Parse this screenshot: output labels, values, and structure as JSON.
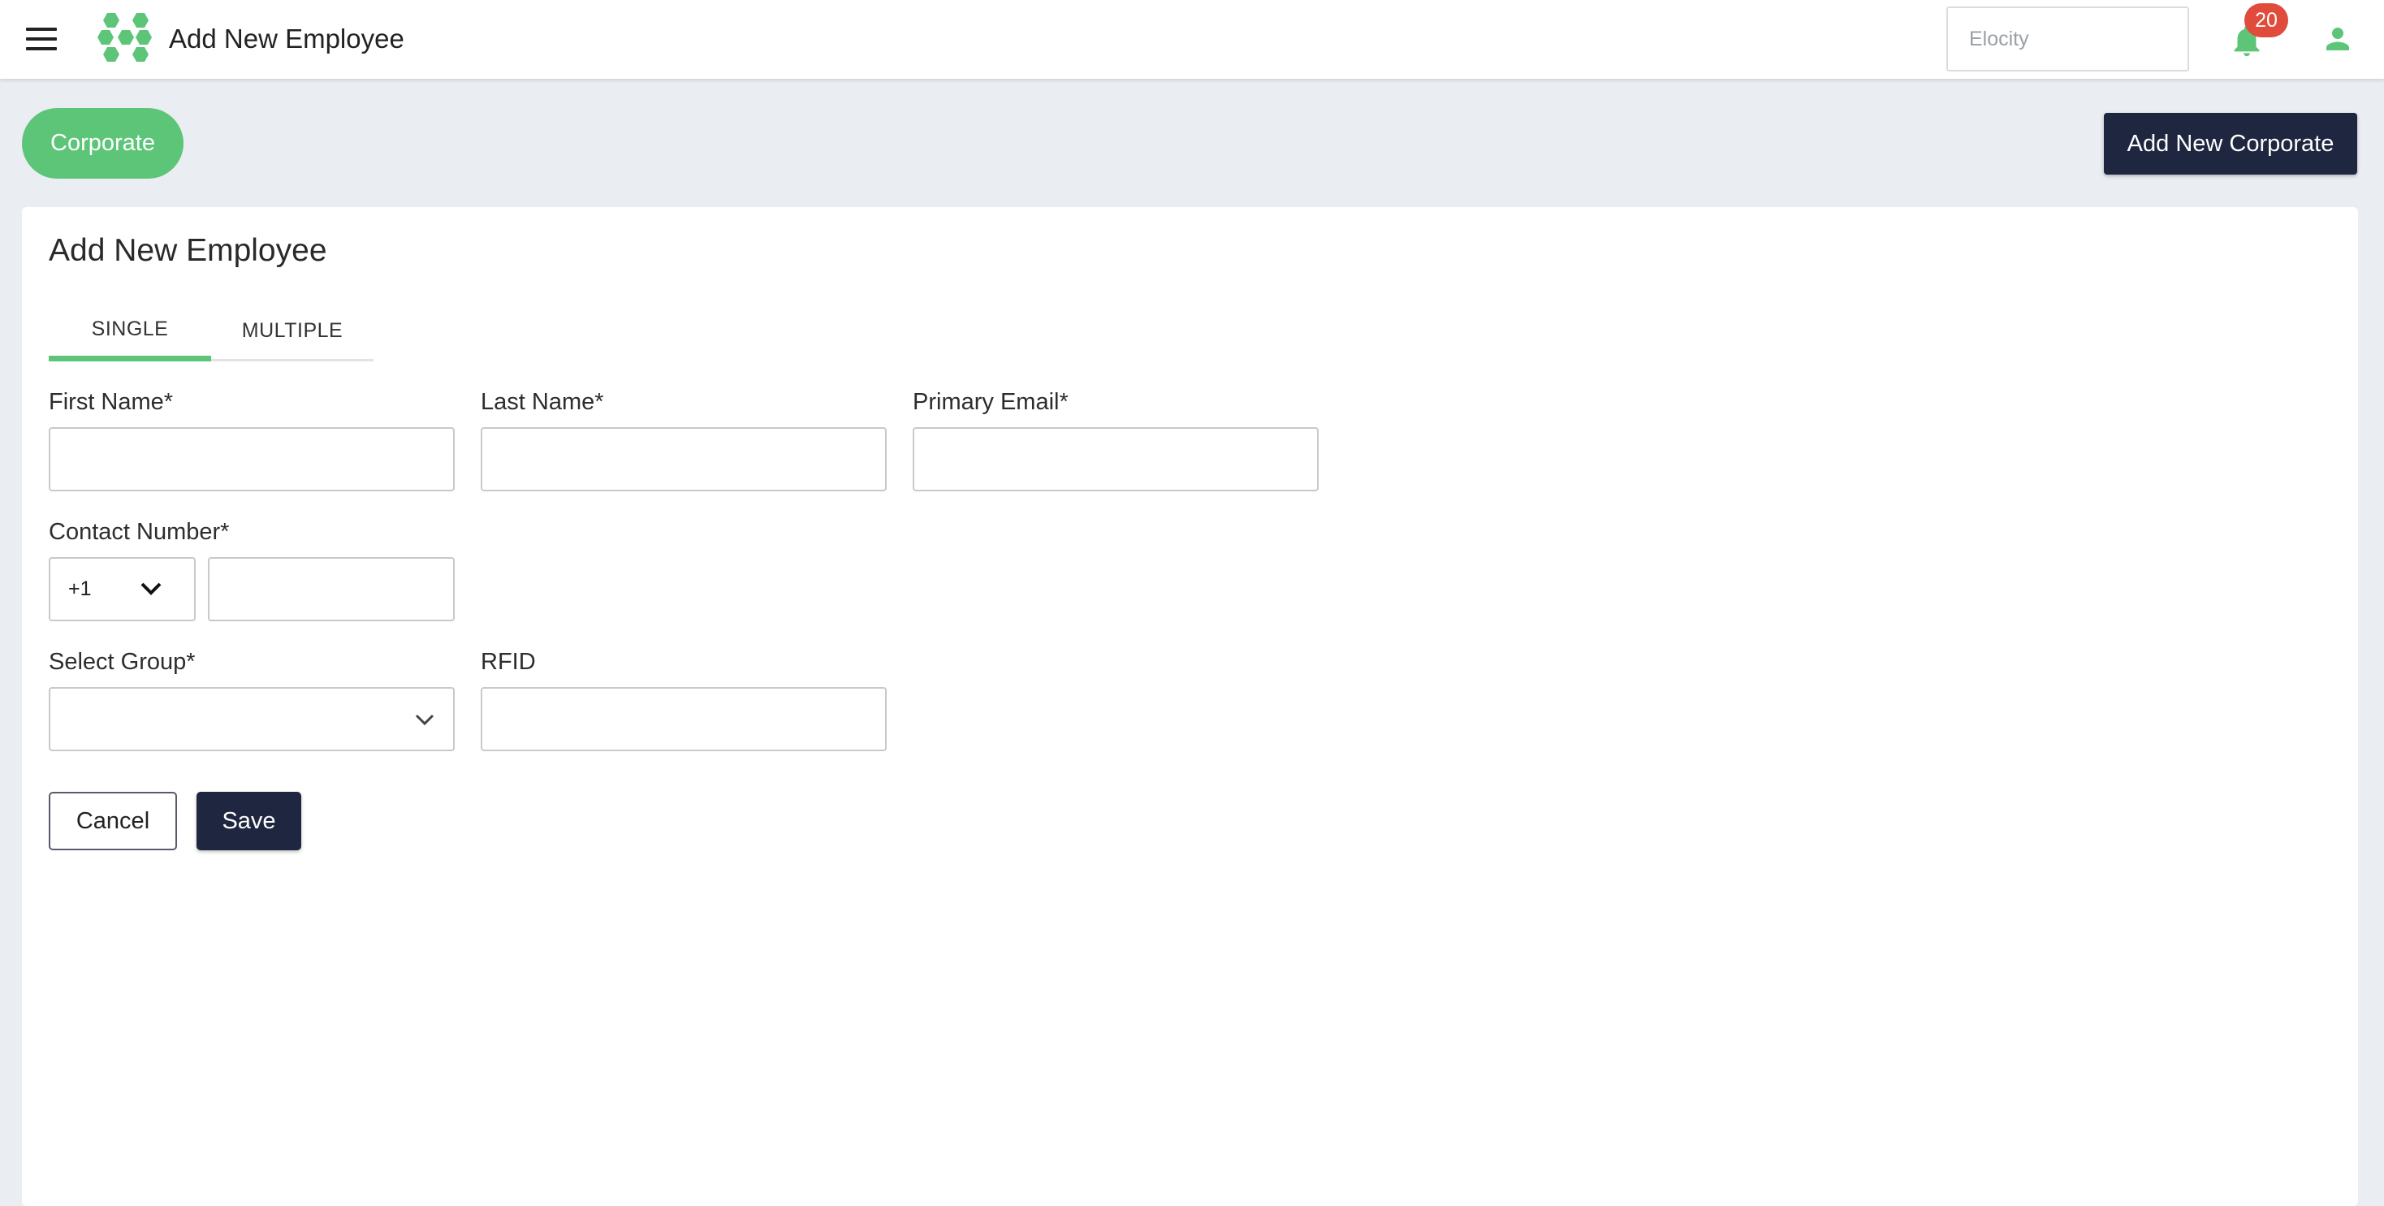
{
  "header": {
    "title": "Add New Employee",
    "org_select_value": "Elocity",
    "notifications_count": "20"
  },
  "toolbar": {
    "corporate_label": "Corporate",
    "add_corporate_label": "Add New Corporate"
  },
  "form": {
    "heading": "Add New Employee",
    "tabs": [
      {
        "label": "SINGLE",
        "active": true
      },
      {
        "label": "MULTIPLE",
        "active": false
      }
    ],
    "fields": {
      "first_name": {
        "label": "First Name*",
        "value": ""
      },
      "last_name": {
        "label": "Last Name*",
        "value": ""
      },
      "primary_email": {
        "label": "Primary Email*",
        "value": ""
      },
      "contact_number": {
        "label": "Contact Number*",
        "country_code": "+1",
        "value": ""
      },
      "select_group": {
        "label": "Select Group*",
        "value": ""
      },
      "rfid": {
        "label": "RFID",
        "value": ""
      }
    },
    "cancel_label": "Cancel",
    "save_label": "Save"
  },
  "colors": {
    "accent_green": "#5dc578",
    "navy": "#1f2640",
    "badge_red": "#e04b3c",
    "background": "#eaedf2"
  },
  "icons": [
    "hamburger-menu-icon",
    "hexagon-logo-icon",
    "bell-icon",
    "user-icon",
    "chevron-down-icon"
  ]
}
